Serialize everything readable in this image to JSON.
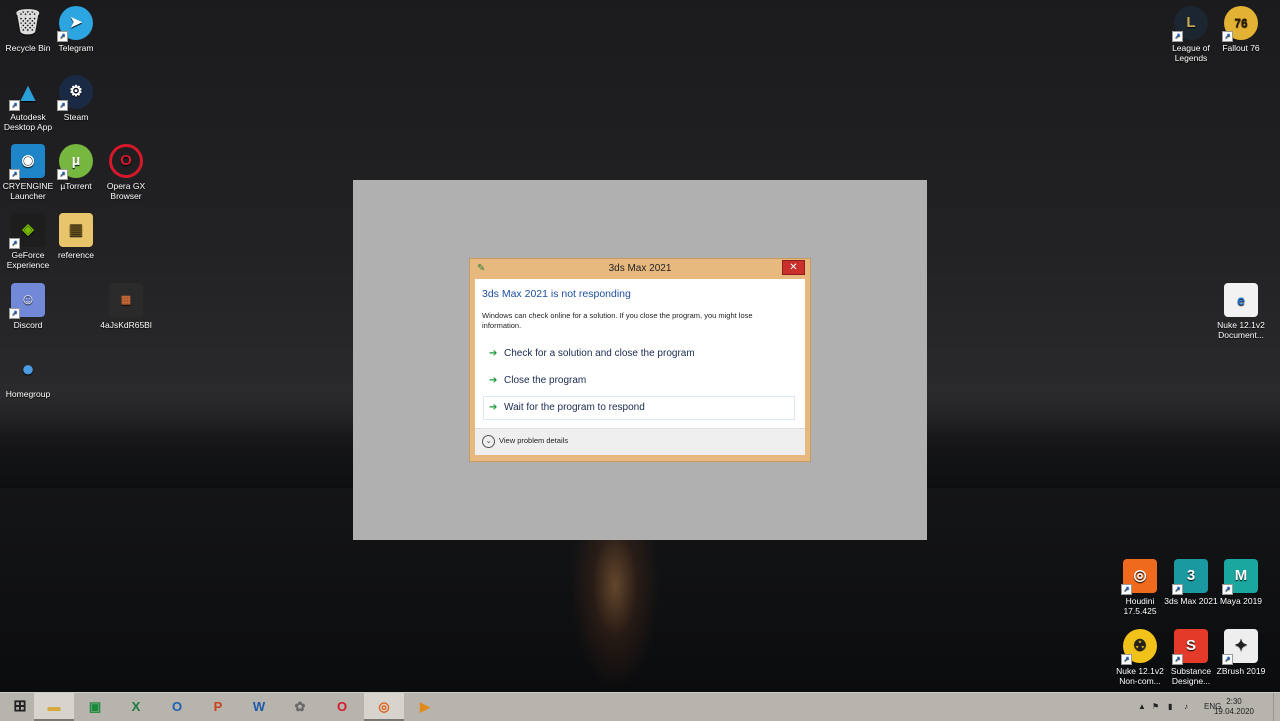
{
  "desktop_icons": {
    "recycle_bin": "Recycle Bin",
    "telegram": "Telegram",
    "autodesk": "Autodesk Desktop App",
    "steam": "Steam",
    "cryengine": "CRYENGINE Launcher",
    "utorrent": "µTorrent",
    "opera": "Opera GX Browser",
    "geforce": "GeForce Experience",
    "reference": "reference",
    "discord": "Discord",
    "file4a": "4aJsKdR65Bl",
    "homegroup": "Homegroup",
    "league": "League of Legends",
    "fallout": "Fallout 76",
    "nuke_doc": "Nuke 12.1v2 Document...",
    "houdini": "Houdini 17.5.425",
    "max": "3ds Max 2021",
    "maya": "Maya 2019",
    "nuke_nc": "Nuke 12.1v2 Non-com...",
    "substance": "Substance Designe...",
    "zbrush": "ZBrush 2019"
  },
  "dialog": {
    "title": "3ds Max 2021",
    "close_glyph": "✕",
    "heading": "3ds Max 2021 is not responding",
    "description": "Windows can check online for a solution. If you close the program, you might lose information.",
    "options": [
      "Check for a solution and close the program",
      "Close the program",
      "Wait for the program to respond"
    ],
    "details": "View problem details"
  },
  "taskbar": {
    "tray_lang": "ENG",
    "time": "2:30",
    "date": "19.04.2020"
  },
  "colors": {
    "dialog_frame": "#e8b97f",
    "close_button": "#c9302c",
    "heading": "#1e4fa0",
    "option_arrow": "#1a9a3a",
    "taskbar": "#b7b3ad"
  }
}
